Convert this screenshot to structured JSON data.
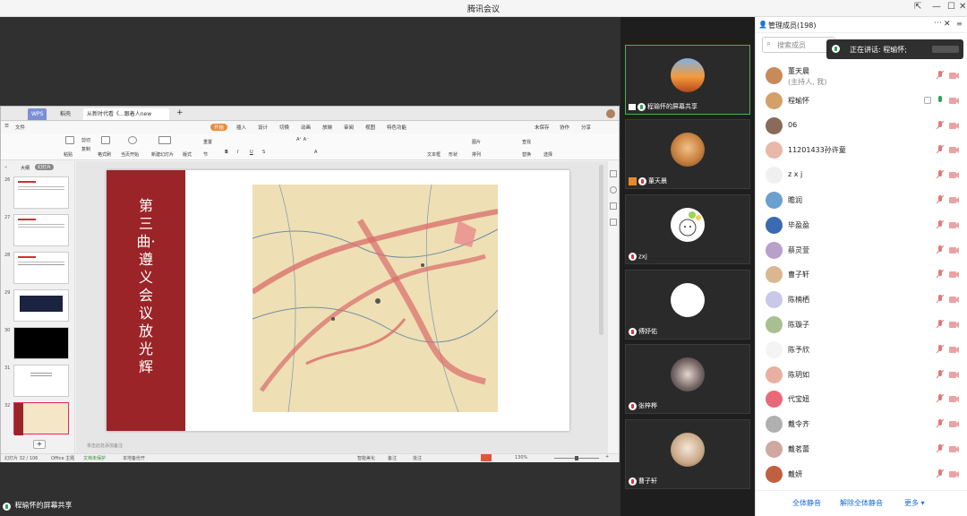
{
  "window": {
    "title": "腾讯会议"
  },
  "share_bar": {
    "label": "程瑜怀的屏幕共享"
  },
  "wps": {
    "tabs": [
      "WPS",
      "稻壳",
      "从新时代看《...跟着人new"
    ],
    "menu": [
      "文件",
      "开始",
      "插入",
      "设计",
      "切换",
      "动画",
      "放映",
      "审阅",
      "视图",
      "特色功能"
    ],
    "menu_right": [
      "未保存",
      "协作",
      "分享"
    ],
    "ribbon": [
      "剪切",
      "复制",
      "粘贴",
      "格式刷",
      "当页开始",
      "新建幻灯片",
      "版式",
      "节",
      "重置",
      "文本框",
      "形状",
      "排列",
      "图片",
      "查找",
      "替换",
      "选择"
    ],
    "left_tabs": [
      "大纲",
      "幻灯片"
    ],
    "thumb_numbers": [
      "26",
      "27",
      "28",
      "29",
      "30",
      "31",
      "32"
    ],
    "slide_title": "第三曲·遵义会议放光辉",
    "notes_placeholder": "单击此处添加备注",
    "status": {
      "page": "幻灯片 32 / 106",
      "theme": "Office 主题",
      "protect": "文档未保护",
      "backup": "本地备份开",
      "beautify": "智能美化",
      "notes": "备注",
      "comments": "批注",
      "zoom": "130%"
    }
  },
  "videos": [
    {
      "name": "程瑜怀的屏幕共享",
      "mic": "on",
      "active": true
    },
    {
      "name": "董天晨",
      "mic": "off"
    },
    {
      "name": "zxj",
      "mic": "off"
    },
    {
      "name": "傅妤佑",
      "mic": "off"
    },
    {
      "name": "张梓桦",
      "mic": "off"
    },
    {
      "name": "曹子轩",
      "mic": "off"
    }
  ],
  "panel": {
    "title": "管理成员(198)",
    "search_placeholder": "搜索成员",
    "speaking_label": "正在讲话: 程瑜怀;",
    "members": [
      {
        "name": "董天晨",
        "sub": "(主持人, 我)"
      },
      {
        "name": "程瑜怀",
        "mic_on": true
      },
      {
        "name": "06"
      },
      {
        "name": "11201433孙许童"
      },
      {
        "name": "z x j"
      },
      {
        "name": "瞻润"
      },
      {
        "name": "毕盈盈"
      },
      {
        "name": "蔡灵萱"
      },
      {
        "name": "曹子轩"
      },
      {
        "name": "陈楠栖"
      },
      {
        "name": "陈璇子"
      },
      {
        "name": "陈予欣"
      },
      {
        "name": "陈玥如"
      },
      {
        "name": "代宝妞"
      },
      {
        "name": "戴令齐"
      },
      {
        "name": "戴茗蕾"
      },
      {
        "name": "戴妍"
      }
    ],
    "footer": [
      "全体静音",
      "解除全体静音",
      "更多"
    ]
  }
}
